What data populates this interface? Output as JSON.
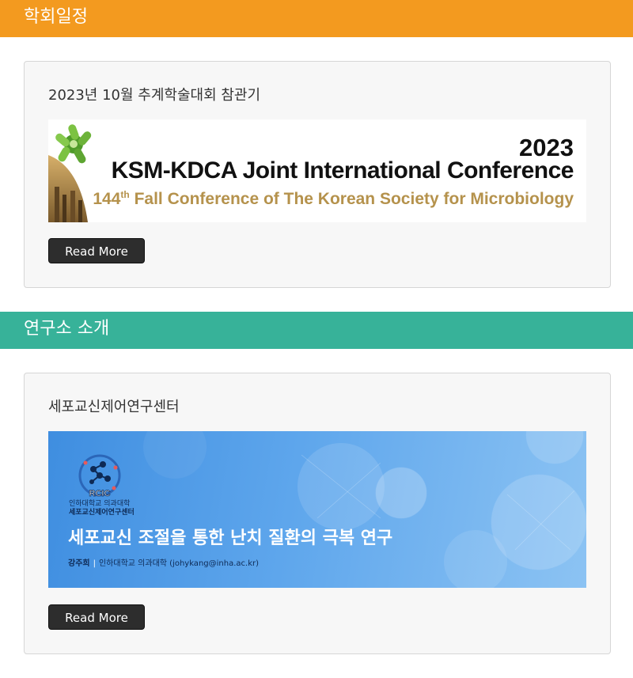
{
  "sections": [
    {
      "header": "학회일정",
      "card": {
        "title": "2023년 10월 추계학술대회 참관기",
        "banner": {
          "year": "2023",
          "conference": "KSM-KDCA Joint International Conference",
          "ordinal_num": "144",
          "ordinal_suffix": "th",
          "subtitle_rest": " Fall Conference of The Korean Society for Microbiology"
        },
        "button": "Read More"
      }
    },
    {
      "header": "연구소 소개",
      "card": {
        "title": "세포교신제어연구센터",
        "banner": {
          "logo_abbr": "RCIC",
          "logo_line1": "인하대학교 의과대학",
          "logo_line2": "세포교신제어연구센터",
          "headline": "세포교신 조절을 통한 난치 질환의 극복 연구",
          "author_name": "강주희",
          "author_sep": "|",
          "author_affil": "인하대학교 의과대학 (johykang@inha.ac.kr)"
        },
        "button": "Read More"
      }
    }
  ],
  "colors": {
    "header_orange": "#f39a1f",
    "header_teal": "#37b299",
    "card_bg": "#f7f7f7",
    "button_bg": "#2d2d2d",
    "conf_gold": "#b5924c",
    "banner_blue": "#4f9ae6"
  },
  "icons": [
    "bacteria-icon",
    "molecule-icon"
  ]
}
